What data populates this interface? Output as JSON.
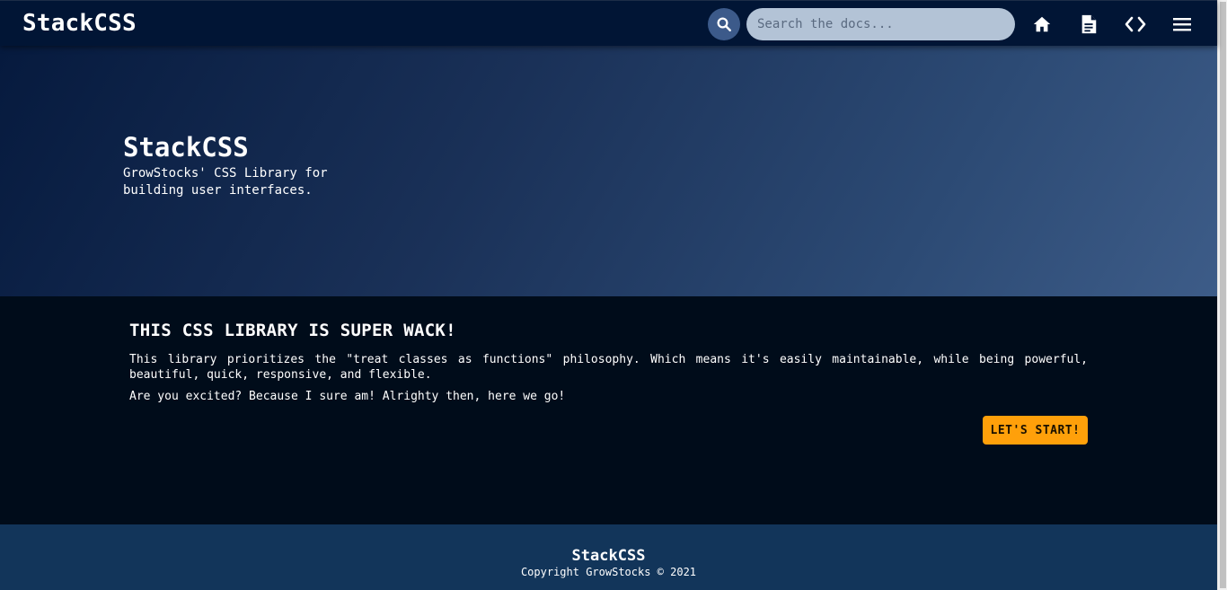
{
  "navbar": {
    "brand": "StackCSS",
    "search_placeholder": "Search the docs...",
    "icons": {
      "search": "search-icon",
      "home": "home-icon",
      "docs": "document-icon",
      "code": "code-icon",
      "menu": "hamburger-menu-icon"
    }
  },
  "hero": {
    "title": "StackCSS",
    "subtitle": "GrowStocks' CSS Library for building user interfaces."
  },
  "main": {
    "heading": "THIS CSS LIBRARY IS SUPER WACK!",
    "paragraph1": "This library prioritizes the \"treat classes as functions\" philosophy. Which means it's easily maintainable, while being powerful, beautiful, quick, responsive, and flexible.",
    "paragraph2": "Are you excited? Because I sure am! Alrighty then, here we go!",
    "start_button": "LET'S START!"
  },
  "footer": {
    "brand": "StackCSS",
    "copyright": "Copyright GrowStocks © 2021"
  },
  "colors": {
    "navbar_bg": "#011535",
    "search_button_bg": "#3c5a8a",
    "search_input_bg": "#b3c3d6",
    "main_bg": "#000c1a",
    "accent_button": "#ffa00a",
    "footer_bg": "#12355a"
  }
}
